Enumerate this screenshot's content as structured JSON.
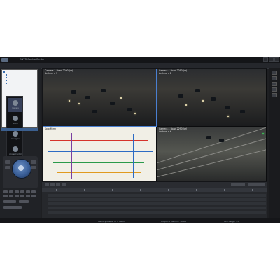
{
  "window": {
    "title": "GNVR ControlCenter"
  },
  "video_tiles": [
    {
      "label": "Camera 1 Road 2290 (cr)\nArchive n 1"
    },
    {
      "label": "Camera 4 Road 2290 (cr)\nArchive n 2"
    },
    {
      "label": "Kolo Mtrm"
    },
    {
      "label": "Camera 4 Road 2290 (cr)\nArchive n 6"
    }
  ],
  "nav_items": [
    "Camera",
    "Zoom",
    "Configure",
    "Access Control"
  ],
  "status": {
    "memory": "Memory Usage: 37% 788M",
    "outputs": "Output of Memory: 16 MB",
    "cpu": "CPU Usage: 5%"
  },
  "colors": {
    "accent": "#4a7fd0",
    "background": "#1e1f22",
    "ptz": "#3a5f98"
  }
}
